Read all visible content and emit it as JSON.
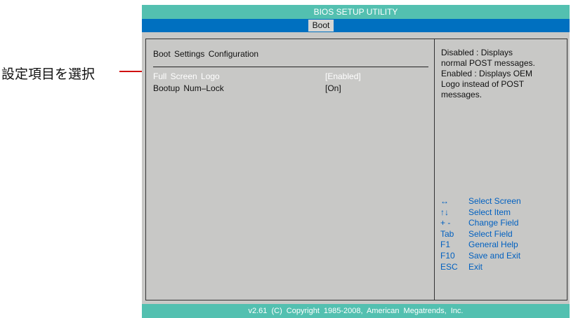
{
  "annotation": {
    "label": "設定項目を選択"
  },
  "bios": {
    "title": "BIOS SETUP UTILITY",
    "tabs": [
      {
        "label": "Boot",
        "selected": true
      }
    ],
    "section_heading": "Boot Settings Configuration",
    "options": [
      {
        "label": "Full Screen Logo",
        "value": "[Enabled]",
        "selected": true
      },
      {
        "label": "Bootup Num–Lock",
        "value": "[On]",
        "selected": false
      }
    ],
    "help_lines": [
      "Disabled : Displays",
      "normal POST messages.",
      "Enabled : Displays OEM",
      "Logo instead of POST",
      "messages."
    ],
    "keys": [
      {
        "key": "↔",
        "action": "Select Screen"
      },
      {
        "key": "↑↓",
        "action": "Select Item"
      },
      {
        "key": "+ -",
        "action": "Change Field"
      },
      {
        "key": "Tab",
        "action": "Select Field"
      },
      {
        "key": "F1",
        "action": "General Help"
      },
      {
        "key": "F10",
        "action": "Save and Exit"
      },
      {
        "key": "ESC",
        "action": "Exit"
      }
    ],
    "footer": "v2.61 (C) Copyright 1985-2008, American Megatrends, Inc."
  },
  "colors": {
    "title_bar": "#53c0b0",
    "tab_bar": "#0070c0",
    "panel_bg": "#c8c8c6",
    "help_keys": "#0060c0",
    "annotation_line": "#d01010"
  }
}
